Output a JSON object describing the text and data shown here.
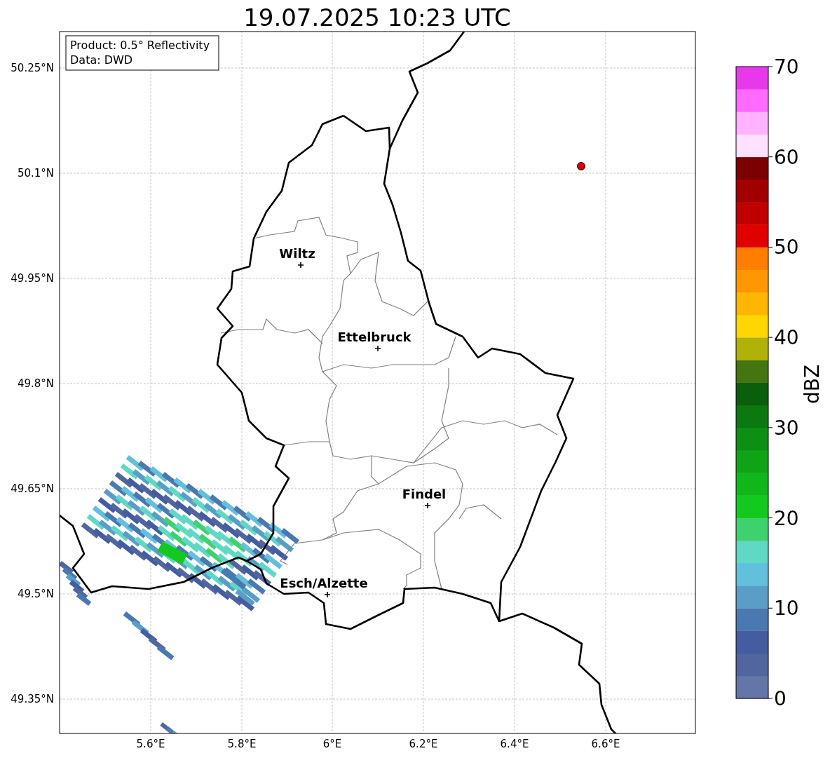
{
  "title": "19.07.2025 10:23 UTC",
  "info_box": [
    "Product: 0.5° Reflectivity",
    "Data: DWD"
  ],
  "map": {
    "lat_ticks": [
      "50.25°N",
      "50.1°N",
      "49.95°N",
      "49.8°N",
      "49.65°N",
      "49.5°N",
      "49.35°N"
    ],
    "lon_ticks": [
      "5.6°E",
      "5.8°E",
      "6°E",
      "6.2°E",
      "6.4°E",
      "6.6°E"
    ],
    "cities": [
      {
        "name": "Wiltz"
      },
      {
        "name": "Ettelbruck"
      },
      {
        "name": "Findel"
      },
      {
        "name": "Esch/Alzette"
      }
    ]
  },
  "colorbar": {
    "label": "dBZ",
    "ticks": [
      "70",
      "60",
      "50",
      "40",
      "30",
      "20",
      "10",
      "0"
    ],
    "bins": [
      {
        "color": "#6475a8"
      },
      {
        "color": "#51659e"
      },
      {
        "color": "#435da0"
      },
      {
        "color": "#4a78b0"
      },
      {
        "color": "#5a9ec8"
      },
      {
        "color": "#62c0dc"
      },
      {
        "color": "#5fd8c4"
      },
      {
        "color": "#3ed26e"
      },
      {
        "color": "#12c91e"
      },
      {
        "color": "#0fb71a"
      },
      {
        "color": "#0fa415"
      },
      {
        "color": "#0d8f13"
      },
      {
        "color": "#0b7810"
      },
      {
        "color": "#0a5e0c"
      },
      {
        "color": "#437610"
      },
      {
        "color": "#b1b209"
      },
      {
        "color": "#ffd600"
      },
      {
        "color": "#ffb600"
      },
      {
        "color": "#ff9800"
      },
      {
        "color": "#ff7e00"
      },
      {
        "color": "#e10000"
      },
      {
        "color": "#c00000"
      },
      {
        "color": "#a00000"
      },
      {
        "color": "#7c0000"
      },
      {
        "color": "#ffe0ff"
      },
      {
        "color": "#ffb2ff"
      },
      {
        "color": "#ff6aff"
      },
      {
        "color": "#e838ec"
      }
    ]
  }
}
